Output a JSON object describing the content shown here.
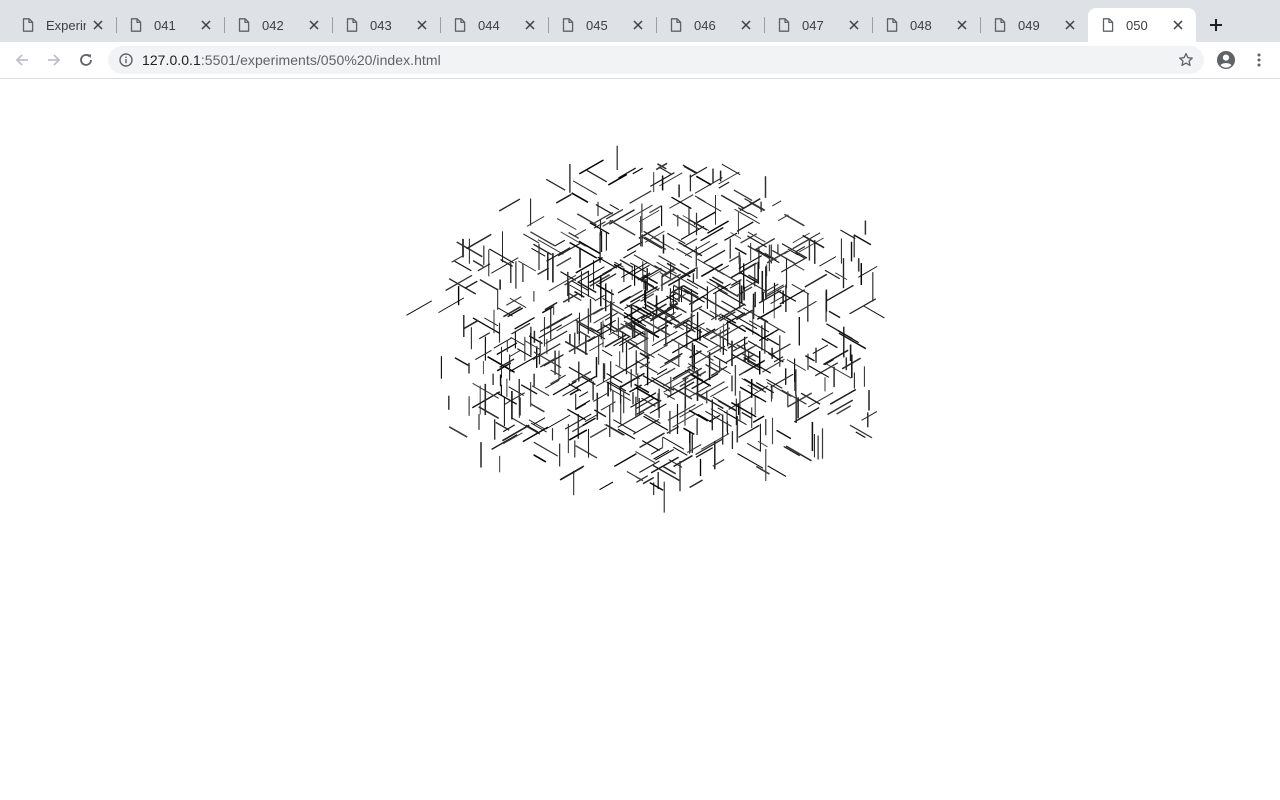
{
  "browser": {
    "tabs": [
      {
        "title": "Experim",
        "active": false
      },
      {
        "title": "041",
        "active": false
      },
      {
        "title": "042",
        "active": false
      },
      {
        "title": "043",
        "active": false
      },
      {
        "title": "044",
        "active": false
      },
      {
        "title": "045",
        "active": false
      },
      {
        "title": "046",
        "active": false
      },
      {
        "title": "047",
        "active": false
      },
      {
        "title": "048",
        "active": false
      },
      {
        "title": "049",
        "active": false
      },
      {
        "title": "050",
        "active": true
      }
    ],
    "new_tab_icon": "plus-icon",
    "nav": {
      "back_icon": "back-arrow-icon",
      "forward_icon": "forward-arrow-icon",
      "reload_icon": "reload-icon"
    },
    "address": {
      "host": "127.0.0.1",
      "rest": ":5501/experiments/050%20/index.html",
      "info_icon": "info-icon",
      "bookmark_icon": "star-icon"
    },
    "profile_icon": "account-circle-icon",
    "menu_icon": "kebab-menu-icon"
  },
  "page": {
    "sketch": {
      "description_color": "#000000",
      "background": "#ffffff"
    }
  }
}
